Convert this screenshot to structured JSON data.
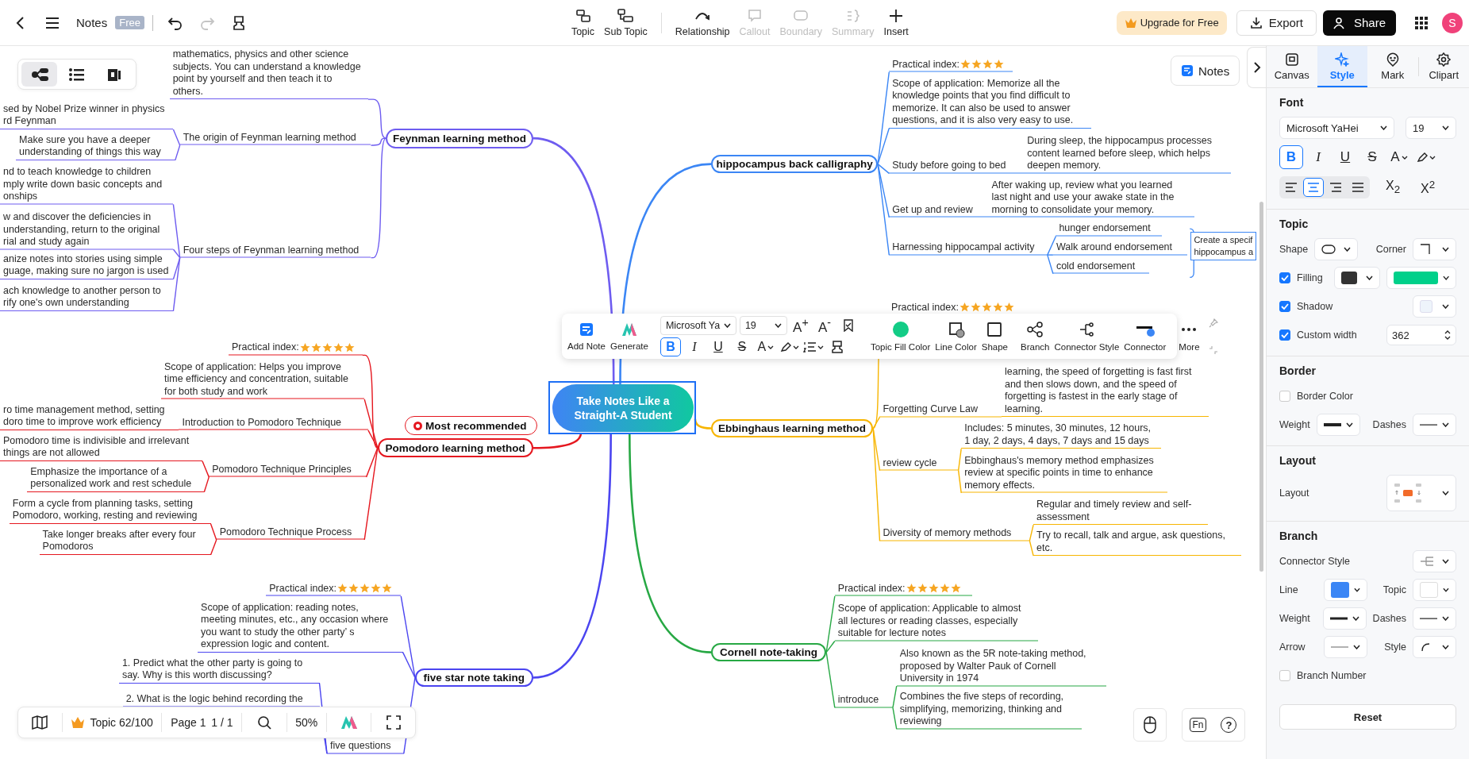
{
  "app_bar": {
    "title": "Notes",
    "plan_badge": "Free",
    "undo_disabled": false,
    "redo_disabled": true,
    "tools": [
      {
        "kind": "topic",
        "label": "Topic",
        "disabled": false
      },
      {
        "kind": "subtopic",
        "label": "Sub Topic",
        "disabled": false
      },
      {
        "kind": "relationship",
        "label": "Relationship",
        "disabled": false
      },
      {
        "kind": "callout",
        "label": "Callout",
        "disabled": true
      },
      {
        "kind": "boundary",
        "label": "Boundary",
        "disabled": true
      },
      {
        "kind": "summary",
        "label": "Summary",
        "disabled": true
      },
      {
        "kind": "insert",
        "label": "Insert",
        "disabled": false
      }
    ],
    "upgrade": "Upgrade for Free",
    "export": "Export",
    "share": "Share",
    "avatar": "S"
  },
  "view_switch": [
    {
      "kind": "mindmap",
      "selected": true
    },
    {
      "kind": "outline",
      "selected": false
    },
    {
      "kind": "slides",
      "selected": false
    }
  ],
  "notes_button": "Notes",
  "mind_map": {
    "central": "Take Notes Like a Straight-A Student",
    "branches": [
      {
        "title": "Feynman learning method",
        "color": "#6e5cf0",
        "children": [
          {
            "text": "mathematics, physics and other science\nsubjects. You can understand a knowledge\npoint by yourself and then teach it to\nothers."
          },
          {
            "text": "The origin of Feynman learning method",
            "children": [
              {
                "text": "sed by Nobel Prize winner in physics\nrd Feynman"
              },
              {
                "text": "Make sure you have a deeper\nunderstanding of things this way"
              }
            ]
          },
          {
            "text": "Four steps of Feynman learning method",
            "children": [
              {
                "text": "nd to teach knowledge to children\nmply write down basic concepts and\nonships"
              },
              {
                "text": "w and discover the deficiencies in\nunderstanding, return to the original\nrial and study again"
              },
              {
                "text": "anize notes into stories using simple\nguage, making sure no jargon is used"
              },
              {
                "text": "ach knowledge to another person to\nrify one's own understanding"
              }
            ]
          }
        ]
      },
      {
        "title": "Pomodoro learning method",
        "color": "#e5171f",
        "badge": "Most recommended",
        "children": [
          {
            "text": "Practical index:",
            "stars": 5
          },
          {
            "text": "Scope of application: Helps you improve\ntime efficiency and concentration, suitable\nfor both study and work"
          },
          {
            "text": "Introduction to Pomodoro Technique",
            "children": [
              {
                "text": "ro time management method, setting\ndoro time to improve work efficiency"
              }
            ]
          },
          {
            "text": "Pomodoro Technique Principles",
            "children": [
              {
                "text": "Pomodoro time is indivisible and irrelevant\nthings are not allowed"
              },
              {
                "text": "Emphasize the importance of a\npersonalized work and rest schedule"
              }
            ]
          },
          {
            "text": "Pomodoro Technique Process",
            "children": [
              {
                "text": "Form a cycle from planning tasks, setting\nPomodoro, working, resting and reviewing"
              },
              {
                "text": "Take longer breaks after every four\nPomodoros"
              }
            ]
          }
        ]
      },
      {
        "title": "five star note taking",
        "color": "#4b45f0",
        "children": [
          {
            "text": "Practical index:",
            "stars": 5
          },
          {
            "text": "Scope of application: reading notes,\nmeeting minutes, etc., any occasion where\nyou want to study the other party’ s\nexpression logic and content."
          },
          {
            "text": "five questions",
            "children": [
              {
                "text": "1. Predict what the other party is going to\nsay. Why is this worth discussing?"
              },
              {
                "text": "2. What is the logic behind recording the"
              }
            ]
          }
        ]
      },
      {
        "title": "hippocampus back calligraphy",
        "color": "#3b86f5",
        "children": [
          {
            "text": "Practical index:",
            "stars": 4
          },
          {
            "text": "Scope of application: Memorize all the\nknowledge points that you find difficult to\nmemorize. It can also be used to answer\nquestions, and it is also very easy to use."
          },
          {
            "text": "Study before going to bed",
            "children": [
              {
                "text": "During sleep, the hippocampus processes\ncontent learned before sleep, which helps\ndeepen memory."
              }
            ]
          },
          {
            "text": "Get up and review",
            "children": [
              {
                "text": "After waking up, review what you learned\nlast night and use your awake state in the\nmorning to consolidate your memory."
              }
            ]
          },
          {
            "text": "Harnessing hippocampal activity",
            "children": [
              {
                "text": "hunger endorsement"
              },
              {
                "text": "Walk around endorsement"
              },
              {
                "text": "cold endorsement"
              }
            ],
            "summary": "Create a specif\nhippocampus a"
          }
        ]
      },
      {
        "title": "Ebbinghaus learning method",
        "color": "#f7b500",
        "children": [
          {
            "text": "Practical index:",
            "stars": 5
          },
          {
            "text": "Forgetting Curve Law",
            "children": [
              {
                "text": "learning, the speed of forgetting is fast first\nand then slows down, and the speed of\nforgetting is fastest in the early stage of\nlearning."
              }
            ]
          },
          {
            "text": "review cycle",
            "children": [
              {
                "text": "Includes: 5 minutes, 30 minutes, 12 hours,\n1 day, 2 days, 4 days, 7 days and 15 days"
              },
              {
                "text": "Ebbinghaus's memory method emphasizes\nreview at specific points in time to enhance\nmemory effects."
              }
            ]
          },
          {
            "text": "Diversity of memory methods",
            "children": [
              {
                "text": "Regular and timely review and self-\nassessment"
              },
              {
                "text": "Try to recall, talk and argue, ask questions,\netc."
              }
            ]
          }
        ]
      },
      {
        "title": "Cornell note-taking",
        "color": "#27a844",
        "children": [
          {
            "text": "Practical index:",
            "stars": 5
          },
          {
            "text": "Scope of application: Applicable to almost\nall lectures or reading classes, especially\nsuitable for lecture notes"
          },
          {
            "text": "introduce",
            "children": [
              {
                "text": "Also known as the 5R note-taking method,\nproposed by Walter Pauk of Cornell\nUniversity in 1974"
              },
              {
                "text": "Combines the five steps of recording,\nsimplifying, memorizing, thinking and\nreviewing"
              }
            ]
          }
        ]
      }
    ]
  },
  "floating_toolbar": {
    "actions": [
      {
        "kind": "note",
        "label": "Add Note"
      },
      {
        "kind": "generate",
        "label": "Generate"
      }
    ],
    "font": "Microsoft Ya",
    "size": "19",
    "font_up": "A$^{+}$",
    "font_down": "A$^{-}$",
    "format": [
      {
        "kind": "bold",
        "label": "B",
        "selected": true
      },
      {
        "kind": "italic",
        "label": "I",
        "selected": false
      },
      {
        "kind": "underline",
        "label": "U",
        "selected": false
      },
      {
        "kind": "strike",
        "label": "S",
        "selected": false
      }
    ],
    "font_color": "A",
    "tools": [
      {
        "kind": "fill",
        "label": "Topic Fill Color"
      },
      {
        "kind": "line",
        "label": "Line Color"
      },
      {
        "kind": "shape",
        "label": "Shape"
      },
      {
        "kind": "branch",
        "label": "Branch"
      },
      {
        "kind": "connector_style",
        "label": "Connector Style"
      },
      {
        "kind": "connector",
        "label": "Connector"
      },
      {
        "kind": "more",
        "label": "More"
      }
    ]
  },
  "style_panel": {
    "tabs": [
      {
        "kind": "canvas",
        "label": "Canvas",
        "selected": false
      },
      {
        "kind": "style",
        "label": "Style",
        "selected": true
      },
      {
        "kind": "mark",
        "label": "Mark",
        "selected": false
      },
      {
        "kind": "clipart",
        "label": "Clipart",
        "selected": false
      }
    ],
    "font": {
      "heading": "Font",
      "family": "Microsoft YaHei",
      "size": "19",
      "format": [
        {
          "kind": "bold",
          "label": "B",
          "selected": true
        },
        {
          "kind": "italic",
          "label": "I",
          "selected": false
        },
        {
          "kind": "underline",
          "label": "U",
          "selected": false
        },
        {
          "kind": "strike",
          "label": "S",
          "selected": false
        }
      ],
      "color_label": "A",
      "align": [
        {
          "kind": "left",
          "selected": false
        },
        {
          "kind": "center",
          "selected": true
        },
        {
          "kind": "right",
          "selected": false
        },
        {
          "kind": "justify",
          "selected": false
        }
      ],
      "subscript": "X$_{2}$",
      "superscript": "X$^{2}$"
    },
    "topic": {
      "heading": "Topic",
      "shape_label": "Shape",
      "corner_label": "Corner",
      "filling": {
        "label": "Filling",
        "checked": true
      },
      "shadow": {
        "label": "Shadow",
        "checked": true
      },
      "custom_width": {
        "label": "Custom width",
        "checked": true,
        "value": "362"
      }
    },
    "border": {
      "heading": "Border",
      "border_color": {
        "label": "Border Color",
        "checked": false
      },
      "weight_label": "Weight",
      "dashes_label": "Dashes"
    },
    "layout": {
      "heading": "Layout",
      "label": "Layout"
    },
    "branch": {
      "heading": "Branch",
      "connector_label": "Connector Style",
      "line_label": "Line",
      "topic_label": "Topic",
      "weight_label": "Weight",
      "dashes_label": "Dashes",
      "arrow_label": "Arrow",
      "style_label": "Style",
      "branch_number": {
        "label": "Branch Number",
        "checked": false
      }
    },
    "reset": "Reset"
  },
  "bottom_bar": {
    "topic_count": "Topic 62/100",
    "page": "Page 1",
    "page_count": "1 / 1",
    "zoom": "50%"
  },
  "help": {
    "fn": "Fn",
    "question": "?"
  }
}
